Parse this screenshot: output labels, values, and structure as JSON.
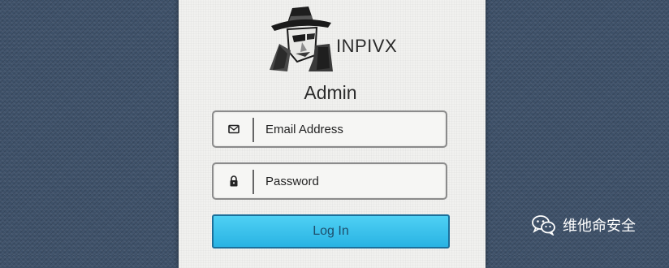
{
  "brand": {
    "name": "INPIVX",
    "logo_icon": "spy-hat-icon"
  },
  "page": {
    "title": "Admin"
  },
  "form": {
    "email": {
      "placeholder": "Email Address",
      "value": "",
      "icon": "envelope-icon"
    },
    "password": {
      "placeholder": "Password",
      "value": "",
      "icon": "lock-icon"
    },
    "login_label": "Log In"
  },
  "watermark": {
    "text": "维他命安全",
    "icon": "wechat-icon"
  },
  "colors": {
    "background": "#3d5068",
    "panel": "#f1f1ef",
    "button": "#28b3e3",
    "button_border": "#1c6f9a"
  }
}
